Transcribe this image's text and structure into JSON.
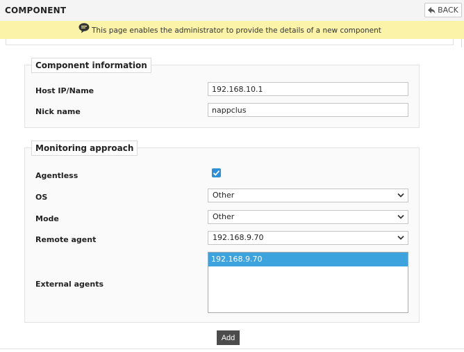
{
  "header": {
    "title": "COMPONENT",
    "back_label": "BACK"
  },
  "banner": {
    "text": "This page enables the administrator to provide the details of a new component",
    "color": "#fbf4a8"
  },
  "component_info": {
    "legend": "Component information",
    "host_label": "Host IP/Name",
    "host_value": "192.168.10.1",
    "nick_label": "Nick name",
    "nick_value": "nappclus"
  },
  "monitoring": {
    "legend": "Monitoring approach",
    "agentless_label": "Agentless",
    "agentless_checked": true,
    "os_label": "OS",
    "os_value": "Other",
    "mode_label": "Mode",
    "mode_value": "Other",
    "remote_agent_label": "Remote agent",
    "remote_agent_value": "192.168.9.70",
    "external_agents_label": "External agents",
    "external_agents_options": [
      "192.168.9.70"
    ]
  },
  "actions": {
    "add_label": "Add"
  },
  "colors": {
    "accent": "#2d8fd6",
    "selected_option": "#3ca3de",
    "button_dark": "#4c4c4c"
  },
  "icons": {
    "back": "back-arrow-icon",
    "info": "speech-bubble-icon",
    "dropdown": "chevron-down-icon",
    "check": "checkmark-icon"
  }
}
